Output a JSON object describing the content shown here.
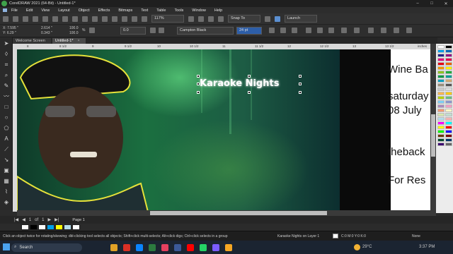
{
  "window": {
    "title": "CorelDRAW 2021 (64-Bit) - Untitled-1*",
    "controls": [
      "–",
      "□",
      "✕"
    ]
  },
  "menu": [
    "File",
    "Edit",
    "View",
    "Layout",
    "Object",
    "Effects",
    "Bitmaps",
    "Text",
    "Table",
    "Tools",
    "Window",
    "Help"
  ],
  "toolbar": {
    "zoom": "117%",
    "snap_to": "Snap To",
    "launch": "Launch"
  },
  "props": {
    "x": "X: 7.595 \"",
    "y": "Y: 6.29 \"",
    "w": "2.614 \"",
    "h": "0.343 \"",
    "sx": "100.0",
    "sy": "100.0",
    "pct": "%",
    "angle": "0.0",
    "font": "Campton Black",
    "size": "24 pt"
  },
  "tabs": [
    {
      "label": "Welcome Screen"
    },
    {
      "label": "Untitled-1*",
      "close": "×"
    }
  ],
  "ruler": {
    "unit": "inches",
    "ticks": [
      "8",
      "8 1/2",
      "9",
      "9 1/2",
      "10",
      "10 1/2",
      "11",
      "11 1/2",
      "12",
      "12 1/2",
      "13",
      "13 1/2"
    ]
  },
  "canvas": {
    "title_text": "Karaoke Nights",
    "side_lines": [
      "Wine Ba",
      "saturday",
      "08 July",
      "theback",
      "For Res"
    ]
  },
  "pagebar": {
    "nav": [
      "|◀",
      "◀",
      "1",
      "of",
      "1",
      "▶",
      "▶|"
    ],
    "page_label": "Page 1"
  },
  "status": {
    "hint": "Click an object twice for rotating/skewing; dbl-clicking tool selects all objects; Shift+click multi-selects; Alt+click digs; Ctrl+click selects in a group",
    "object": "Karaoke Nights  on Layer 1",
    "fill": "C:0 M:0 Y:0 K:0",
    "outline": "None"
  },
  "taskbar": {
    "search": "Search",
    "temp": "29°C",
    "time": "3:37 PM"
  },
  "colors": {
    "accent": "#5b8fd1",
    "selection_handle": "#111111"
  },
  "palette": [
    "#ffffff",
    "#000000",
    "#00a0e9",
    "#0068b7",
    "#1d2088",
    "#920783",
    "#e4007f",
    "#e5004f",
    "#e60012",
    "#eb6100",
    "#f39800",
    "#fff100",
    "#8fc31f",
    "#22ac38",
    "#009944",
    "#009e96",
    "#00a0c1",
    "#cfa972",
    "#9b8f7c",
    "#595757",
    "#c9caca",
    "#dcdddd",
    "#f8b551",
    "#fcc800",
    "#b5d100",
    "#69bd83",
    "#7ecef4",
    "#8c97cb",
    "#aa89bd",
    "#f19ec2",
    "#f29b76",
    "#fffbc7",
    "#d7e7af",
    "#c0dfd2",
    "#b3dceb",
    "#f5b2b2",
    "#ff00ff",
    "#00ffff",
    "#ffff00",
    "#ff0000",
    "#00ff00",
    "#0000ff",
    "#6a3906",
    "#7b0000",
    "#004a2f",
    "#00366b",
    "#3a006f",
    "#666666"
  ],
  "doc_palette": [
    "#ffffff",
    "#000000",
    "#ffffff",
    "#00a0e9",
    "#ffff00",
    "#b3dceb",
    "#ffffff"
  ]
}
